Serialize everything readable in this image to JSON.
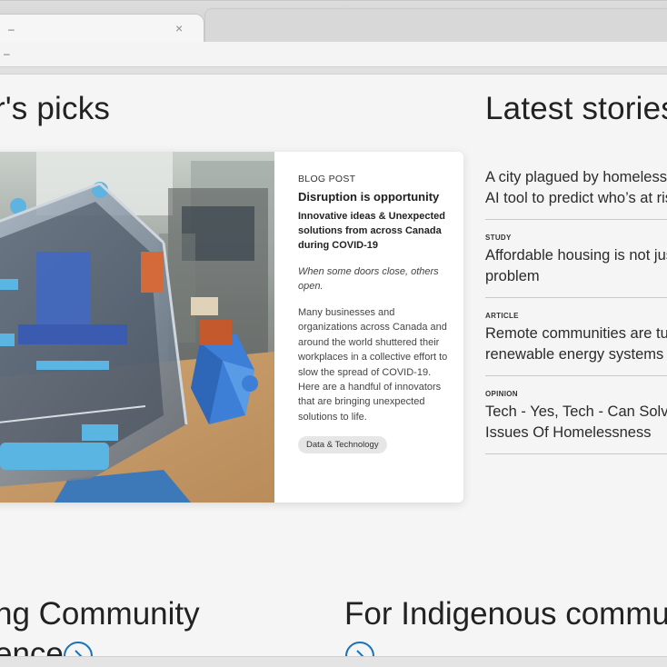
{
  "browser": {
    "tab_title": "–",
    "tab_close": "×",
    "address_text": "–"
  },
  "sections": {
    "picks_title": "r's picks",
    "latest_title": "Latest stories"
  },
  "featured": {
    "kicker": "BLOG POST",
    "title": "Disruption is opportunity",
    "subtitle": "Innovative ideas & Unexpected solutions from across Canada during COVID-19",
    "italic": "When some doors close, others open.",
    "description": "Many businesses and organizations across Canada and around the world shuttered their workplaces in a collective effort to slow the spread of COVID-19. Here are a handful of innovators that are bringing unexpected solutions to life.",
    "tag": "Data & Technology"
  },
  "stories": [
    {
      "kicker": "",
      "line1": "A city plagued by homelessn",
      "line2": "AI tool to predict who’s at ris"
    },
    {
      "kicker": "STUDY",
      "line1": "Affordable housing is not jus",
      "line2": "problem"
    },
    {
      "kicker": "ARTICLE",
      "line1": "Remote communities are tur",
      "line2": "renewable energy systems"
    },
    {
      "kicker": "OPINION",
      "line1": "Tech - Yes, Tech - Can Solve T",
      "line2": "Issues Of Homelessness"
    }
  ],
  "bottom": {
    "community_line1": "ng Community",
    "community_line2": "ence",
    "indigenous_title": "For Indigenous commun"
  },
  "colors": {
    "accent": "#1a73b8",
    "page_bg": "#f5f5f5",
    "card_bg": "#ffffff"
  }
}
